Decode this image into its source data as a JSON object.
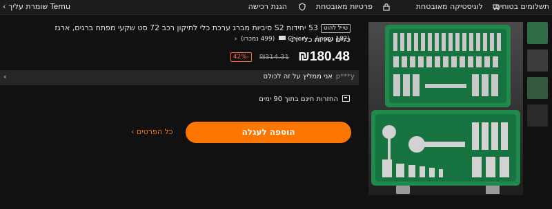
{
  "topbar": {
    "safe_payments": "תשלומים בטוחים",
    "verified_logistics": "לוגיסטיקה מאובטחת",
    "privacy": "פרטיות מאובטחת",
    "purchase_protection": "הגנת רכישה",
    "temu_account": "Temu שומרת עליך"
  },
  "product": {
    "tag": "טייל להוט",
    "title": "53 יחידות S2 סיביות מברג ערכת כלי לתיקון רכב 72 סט שקעי מפתח ברגים, ארגז כלים שירות כלי ידני",
    "reviews": "(182 נמכרו),",
    "store_name": "Chiory",
    "store_sold": "(499 נמכרו)",
    "price": "₪180.48",
    "old_price": "₪314.31",
    "discount": "-42%"
  },
  "review_bar": {
    "user": "p***y",
    "text": "אני ממליץ על זה לכולם",
    "chevron": "‹"
  },
  "returns": {
    "text": "החזרות חינם בתוך 90 ימים"
  },
  "actions": {
    "add_to_cart": "הוספה לעגלה",
    "all_details": "כל הפרטים ›"
  },
  "colors": {
    "accent": "#fb7701",
    "discount": "#ff6a3d",
    "case_green": "#1f8a4c"
  }
}
